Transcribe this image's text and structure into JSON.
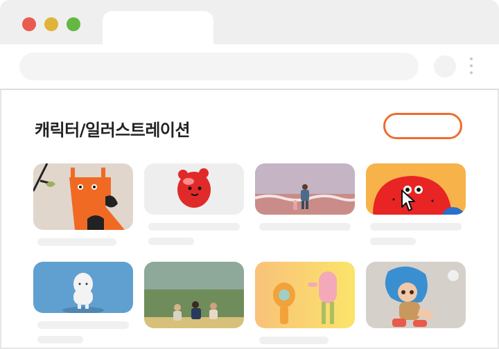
{
  "window": {
    "controls": [
      "close",
      "minimize",
      "maximize"
    ],
    "tab_title": "",
    "address_value": ""
  },
  "page": {
    "heading": "캐릭터/일러스트레이션",
    "action_button_label": ""
  },
  "cards": [
    {
      "row": 1,
      "illustration": "orange-giraffe-character"
    },
    {
      "row": 1,
      "illustration": "red-gummy-bear-character"
    },
    {
      "row": 1,
      "illustration": "person-walking-beach-photo"
    },
    {
      "row": 1,
      "illustration": "red-blob-character-with-eyes"
    },
    {
      "row": 2,
      "illustration": "white-fluffy-sheep-figure"
    },
    {
      "row": 2,
      "illustration": "people-sitting-on-field"
    },
    {
      "row": 2,
      "illustration": "lightbulb-and-pink-creature"
    },
    {
      "row": 2,
      "illustration": "blue-haired-3d-girl-running"
    }
  ],
  "colors": {
    "accent": "#f06a2e",
    "placeholder": "#f0f0f0",
    "chrome": "#efefef"
  },
  "cursor": "arrow-pointer-icon"
}
